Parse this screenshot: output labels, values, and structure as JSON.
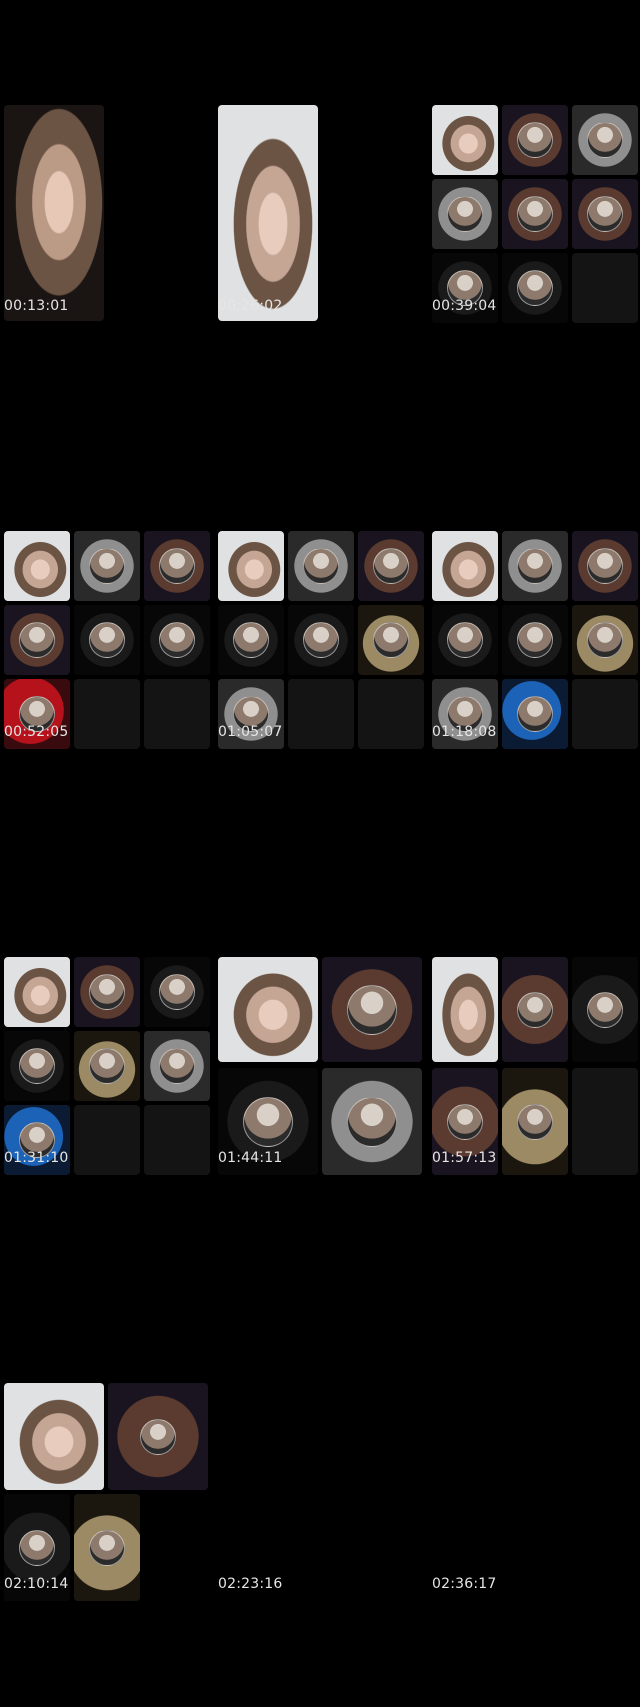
{
  "timestamps": [
    "00:13:01",
    "00:26:02",
    "00:39:04",
    "00:52:05",
    "01:05:07",
    "01:18:08",
    "01:31:10",
    "01:44:11",
    "01:57:13",
    "02:10:14",
    "02:23:16",
    "02:36:17"
  ]
}
